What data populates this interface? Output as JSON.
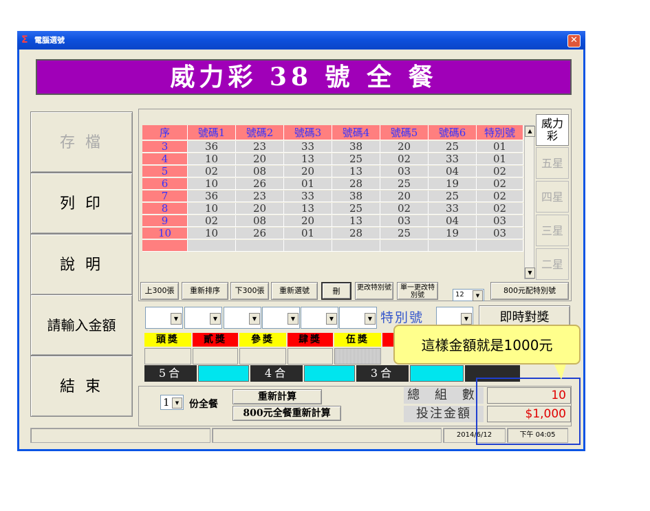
{
  "window": {
    "title": "電腦選號",
    "close": "✕"
  },
  "banner": "威力彩 38 號 全 餐",
  "left_buttons": [
    "存 檔",
    "列 印",
    "說 明",
    "請輸入金額",
    "結 束"
  ],
  "grid": {
    "headers": [
      "序",
      "號碼1",
      "號碼2",
      "號碼3",
      "號碼4",
      "號碼5",
      "號碼6",
      "特別號"
    ],
    "rows": [
      [
        "3",
        "36",
        "23",
        "33",
        "38",
        "20",
        "25",
        "01"
      ],
      [
        "4",
        "10",
        "20",
        "13",
        "25",
        "02",
        "33",
        "01"
      ],
      [
        "5",
        "02",
        "08",
        "20",
        "13",
        "03",
        "04",
        "02"
      ],
      [
        "6",
        "10",
        "26",
        "01",
        "28",
        "25",
        "19",
        "02"
      ],
      [
        "7",
        "36",
        "23",
        "33",
        "38",
        "20",
        "25",
        "02"
      ],
      [
        "8",
        "10",
        "20",
        "13",
        "25",
        "02",
        "33",
        "02"
      ],
      [
        "9",
        "02",
        "08",
        "20",
        "13",
        "03",
        "04",
        "03"
      ],
      [
        "10",
        "10",
        "26",
        "01",
        "28",
        "25",
        "19",
        "03"
      ]
    ]
  },
  "right_tabs": [
    "威力彩",
    "五星",
    "四星",
    "三星",
    "二星"
  ],
  "small_buttons": [
    "上300張",
    "重新排序",
    "下300張",
    "重新選號",
    "刪",
    "更改特別號",
    "單一更改特別號",
    "800元配特別號"
  ],
  "count_select": "12",
  "special_label": "特別號",
  "instant_button": "即時對獎",
  "prizes": [
    "頭獎",
    "貳獎",
    "參獎",
    "肆獎",
    "伍獎"
  ],
  "hit_labels": [
    "5合",
    "4合",
    "3合"
  ],
  "quantity_select": "1",
  "quantity_label": "份全餐",
  "recalc_button": "重新計算",
  "recalc800_button": "800元全餐重新計算",
  "total_groups_label": "總 組 數",
  "total_groups_value": "10",
  "bet_amount_label": "投注金額",
  "bet_amount_value": "$1,000",
  "status": {
    "date": "2014/6/12",
    "time": "下午 04:05"
  },
  "callout": "這樣金額就是1000元",
  "colors": {
    "banner": "#A000B8",
    "header": "#FF7F7F",
    "cyan": "#00E5EE",
    "callout": "#FFFF8C"
  }
}
